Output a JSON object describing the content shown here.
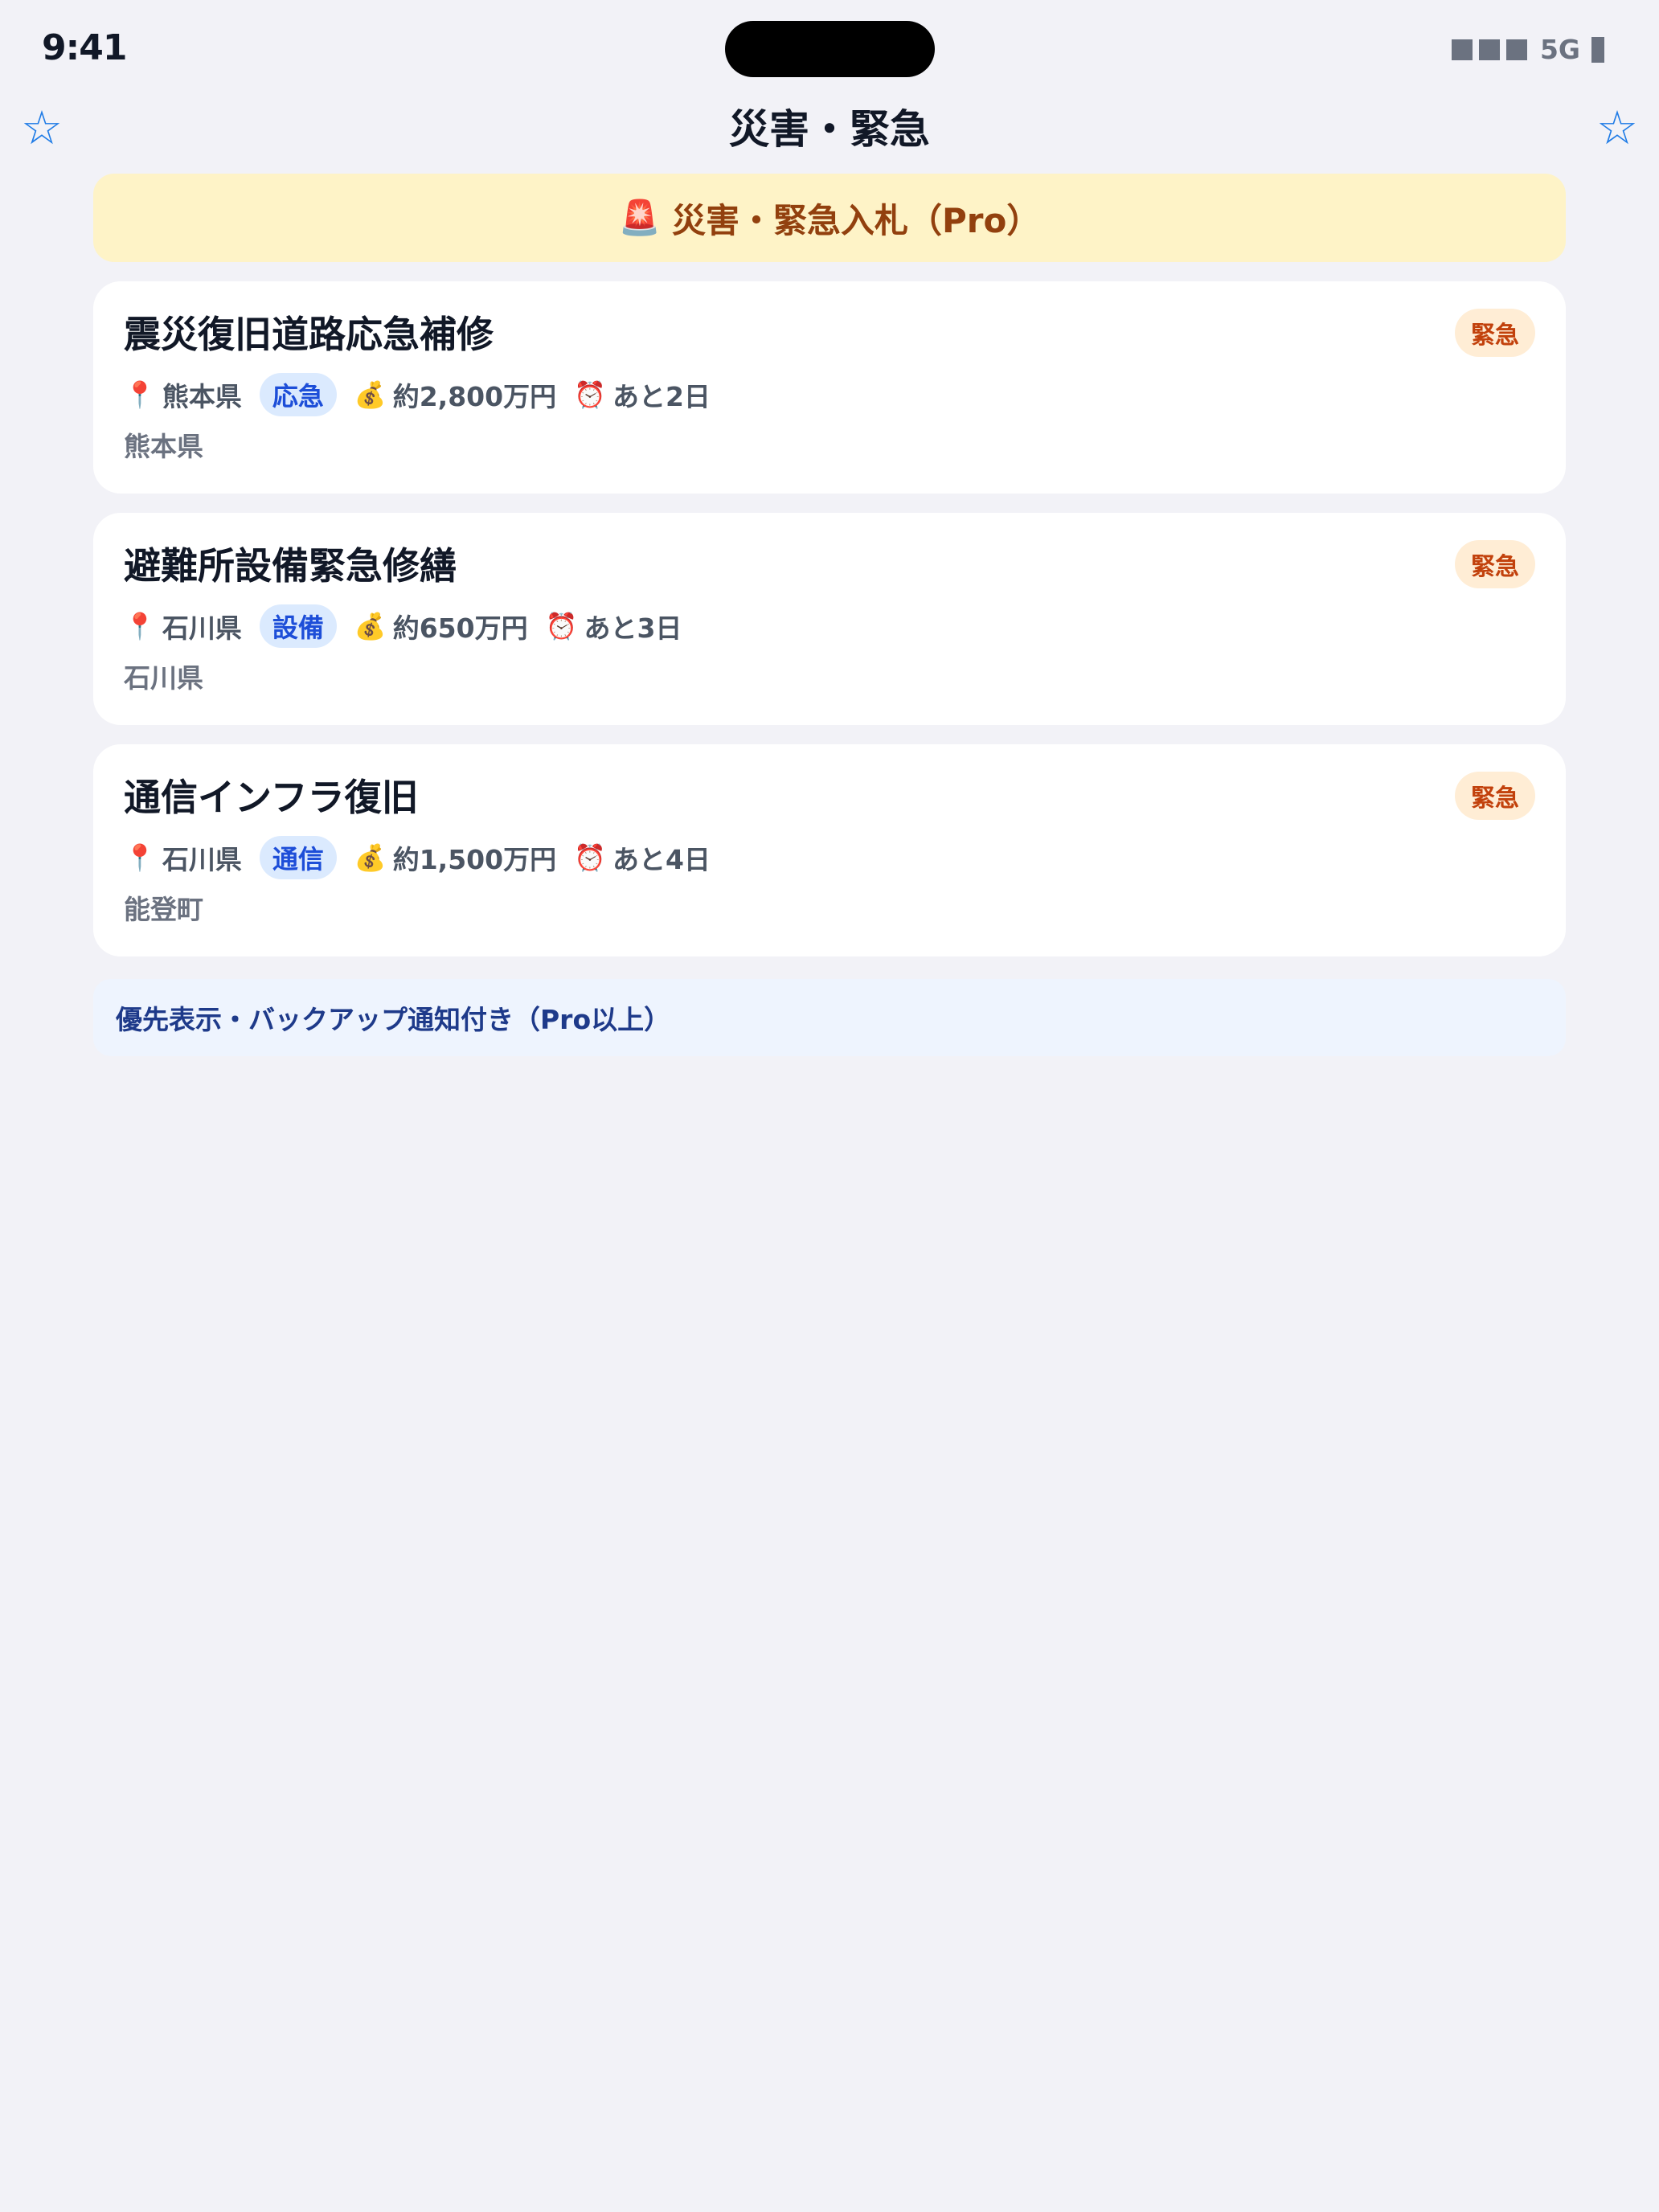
{
  "status_bar": {
    "time": "9:41",
    "network": "5G"
  },
  "nav": {
    "title": "災害・緊急",
    "left_icon": "star-outline-icon",
    "right_icon": "star-outline-icon",
    "accent_color": "#1e7be6"
  },
  "banner": {
    "icon": "🚨",
    "text": "災害・緊急入札（Pro）",
    "background": "#fef3c7"
  },
  "cards": [
    {
      "title": "震災復旧道路応急補修",
      "badge": "緊急",
      "pin": "📍",
      "prefecture": "熊本県",
      "category": "応急",
      "money_icon": "💰",
      "amount": "約2,800万円",
      "clock_icon": "⏰",
      "deadline": "あと2日",
      "location": "熊本県"
    },
    {
      "title": "避難所設備緊急修繕",
      "badge": "緊急",
      "pin": "📍",
      "prefecture": "石川県",
      "category": "設備",
      "money_icon": "💰",
      "amount": "約650万円",
      "clock_icon": "⏰",
      "deadline": "あと3日",
      "location": "石川県"
    },
    {
      "title": "通信インフラ復旧",
      "badge": "緊急",
      "pin": "📍",
      "prefecture": "石川県",
      "category": "通信",
      "money_icon": "💰",
      "amount": "約1,500万円",
      "clock_icon": "⏰",
      "deadline": "あと4日",
      "location": "能登町"
    }
  ],
  "footnote": {
    "text": "優先表示・バックアップ通知付き（Pro以上）"
  }
}
